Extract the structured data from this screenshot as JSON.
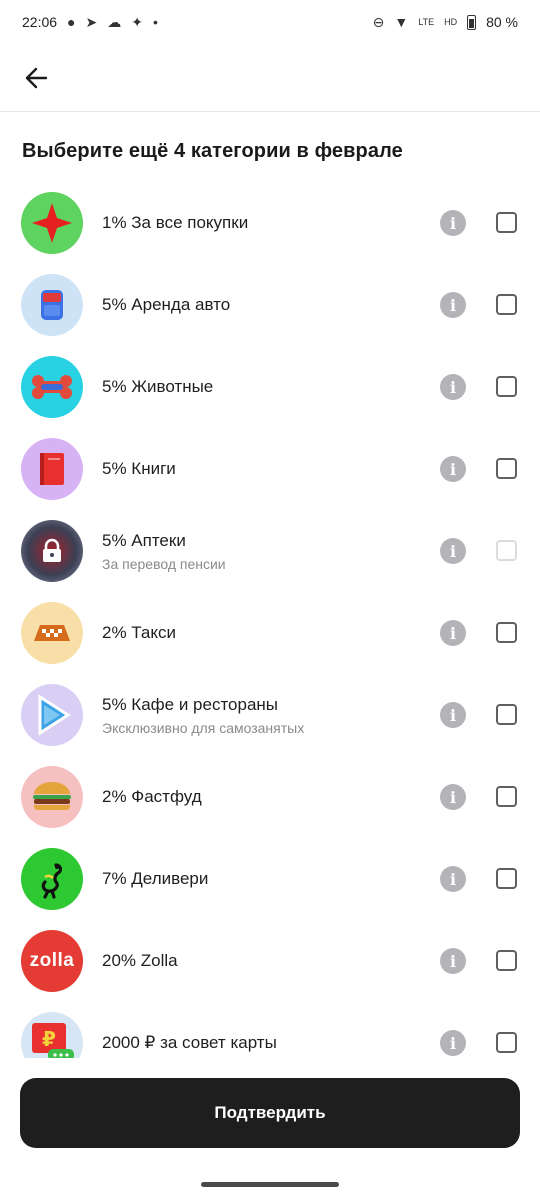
{
  "status": {
    "time": "22:06",
    "battery": "80 %",
    "network": "LTE",
    "hd": "HD"
  },
  "header": {
    "back_icon": "arrow-left-icon"
  },
  "title": "Выберите ещё 4 категории в феврале",
  "categories": [
    {
      "label": "1% За все покупки",
      "subtitle": "",
      "icon": "red-star-icon",
      "icon_bg": "#5fd35f",
      "disabled": false
    },
    {
      "label": "5% Аренда авто",
      "subtitle": "",
      "icon": "car-rental-icon",
      "icon_bg": "#cfe3f7",
      "disabled": false
    },
    {
      "label": "5% Животные",
      "subtitle": "",
      "icon": "bone-icon",
      "icon_bg": "#29d2e3",
      "disabled": false
    },
    {
      "label": "5% Книги",
      "subtitle": "",
      "icon": "book-icon",
      "icon_bg": "#d7b3f5",
      "disabled": false
    },
    {
      "label": "5% Аптеки",
      "subtitle": "За перевод пенсии",
      "icon": "lock-icon",
      "icon_bg": "#3b4055",
      "disabled": true
    },
    {
      "label": "2% Такси",
      "subtitle": "",
      "icon": "taxi-icon",
      "icon_bg": "#f8dfa8",
      "disabled": false
    },
    {
      "label": "5% Кафе и рестораны",
      "subtitle": "Эксклюзивно для самозанятых",
      "icon": "play-icon",
      "icon_bg": "#d9cff5",
      "disabled": false
    },
    {
      "label": "2% Фастфуд",
      "subtitle": "",
      "icon": "burger-icon",
      "icon_bg": "#f7c0c0",
      "disabled": false
    },
    {
      "label": "7% Деливери",
      "subtitle": "",
      "icon": "ostrich-icon",
      "icon_bg": "#2ec932",
      "disabled": false
    },
    {
      "label": "20% Zolla",
      "subtitle": "",
      "icon": "zolla-logo-icon",
      "icon_bg": "#e43b34",
      "icon_text": "zolla",
      "disabled": false
    },
    {
      "label": "2000 ₽ за совет карты",
      "subtitle": "",
      "icon": "ruble-card-icon",
      "icon_bg": "#d6e6f5",
      "disabled": false
    }
  ],
  "confirm_label": "Подтвердить"
}
